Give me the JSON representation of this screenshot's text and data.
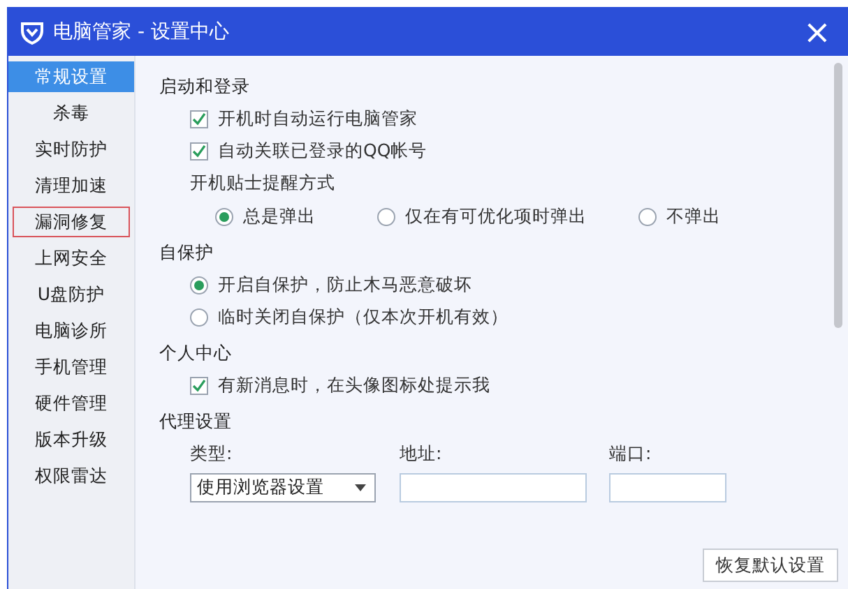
{
  "window": {
    "title": "电脑管家 - 设置中心",
    "close": "×"
  },
  "sidebar": {
    "items": [
      {
        "label": "常规设置",
        "selected": true,
        "focused": false
      },
      {
        "label": "杀毒",
        "selected": false,
        "focused": false
      },
      {
        "label": "实时防护",
        "selected": false,
        "focused": false
      },
      {
        "label": "清理加速",
        "selected": false,
        "focused": false
      },
      {
        "label": "漏洞修复",
        "selected": false,
        "focused": true
      },
      {
        "label": "上网安全",
        "selected": false,
        "focused": false
      },
      {
        "label": "U盘防护",
        "selected": false,
        "focused": false
      },
      {
        "label": "电脑诊所",
        "selected": false,
        "focused": false
      },
      {
        "label": "手机管理",
        "selected": false,
        "focused": false
      },
      {
        "label": "硬件管理",
        "selected": false,
        "focused": false
      },
      {
        "label": "版本升级",
        "selected": false,
        "focused": false
      },
      {
        "label": "权限雷达",
        "selected": false,
        "focused": false
      }
    ]
  },
  "sections": [
    {
      "title": "启动和登录",
      "items": [
        {
          "kind": "checkbox",
          "label": "开机时自动运行电脑管家",
          "checked": true
        },
        {
          "kind": "checkbox",
          "label": "自动关联已登录的QQ帐号",
          "checked": true
        },
        {
          "kind": "label",
          "label": "开机贴士提醒方式"
        },
        {
          "kind": "radio_row",
          "options": [
            {
              "label": "总是弹出",
              "selected": true
            },
            {
              "label": "仅在有可优化项时弹出",
              "selected": false
            },
            {
              "label": "不弹出",
              "selected": false
            }
          ]
        }
      ]
    },
    {
      "title": "自保护",
      "items": [
        {
          "kind": "radio",
          "label": "开启自保护，防止木马恶意破坏",
          "selected": true
        },
        {
          "kind": "radio",
          "label": "临时关闭自保护（仅本次开机有效）",
          "selected": false
        }
      ]
    },
    {
      "title": "个人中心",
      "items": [
        {
          "kind": "checkbox",
          "label": "有新消息时，在头像图标处提示我",
          "checked": true
        }
      ]
    },
    {
      "title": "代理设置",
      "items": [
        {
          "kind": "proxy",
          "type_label": "类型:",
          "type_value": "使用浏览器设置",
          "address_label": "地址:",
          "port_label": "端口:"
        }
      ]
    }
  ],
  "restore_button": "恢复默认设置"
}
